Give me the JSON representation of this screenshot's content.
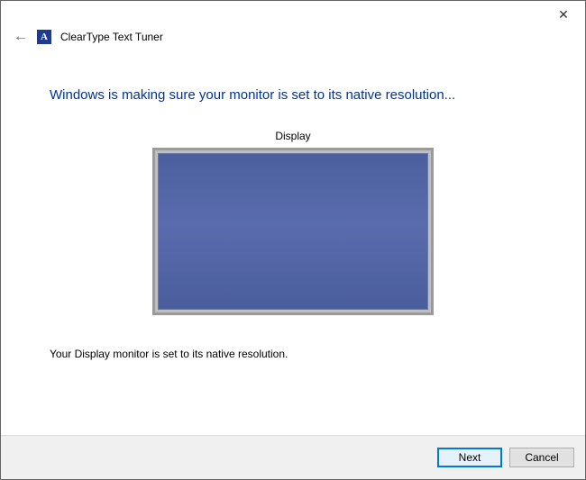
{
  "window": {
    "close_glyph": "✕"
  },
  "header": {
    "back_glyph": "←",
    "app_icon_letter": "A",
    "app_title": "ClearType Text Tuner"
  },
  "main": {
    "headline": "Windows is making sure your monitor is set to its native resolution...",
    "display_label": "Display",
    "status_text": "Your Display monitor is set to its native resolution."
  },
  "footer": {
    "next_label": "Next",
    "cancel_label": "Cancel"
  }
}
